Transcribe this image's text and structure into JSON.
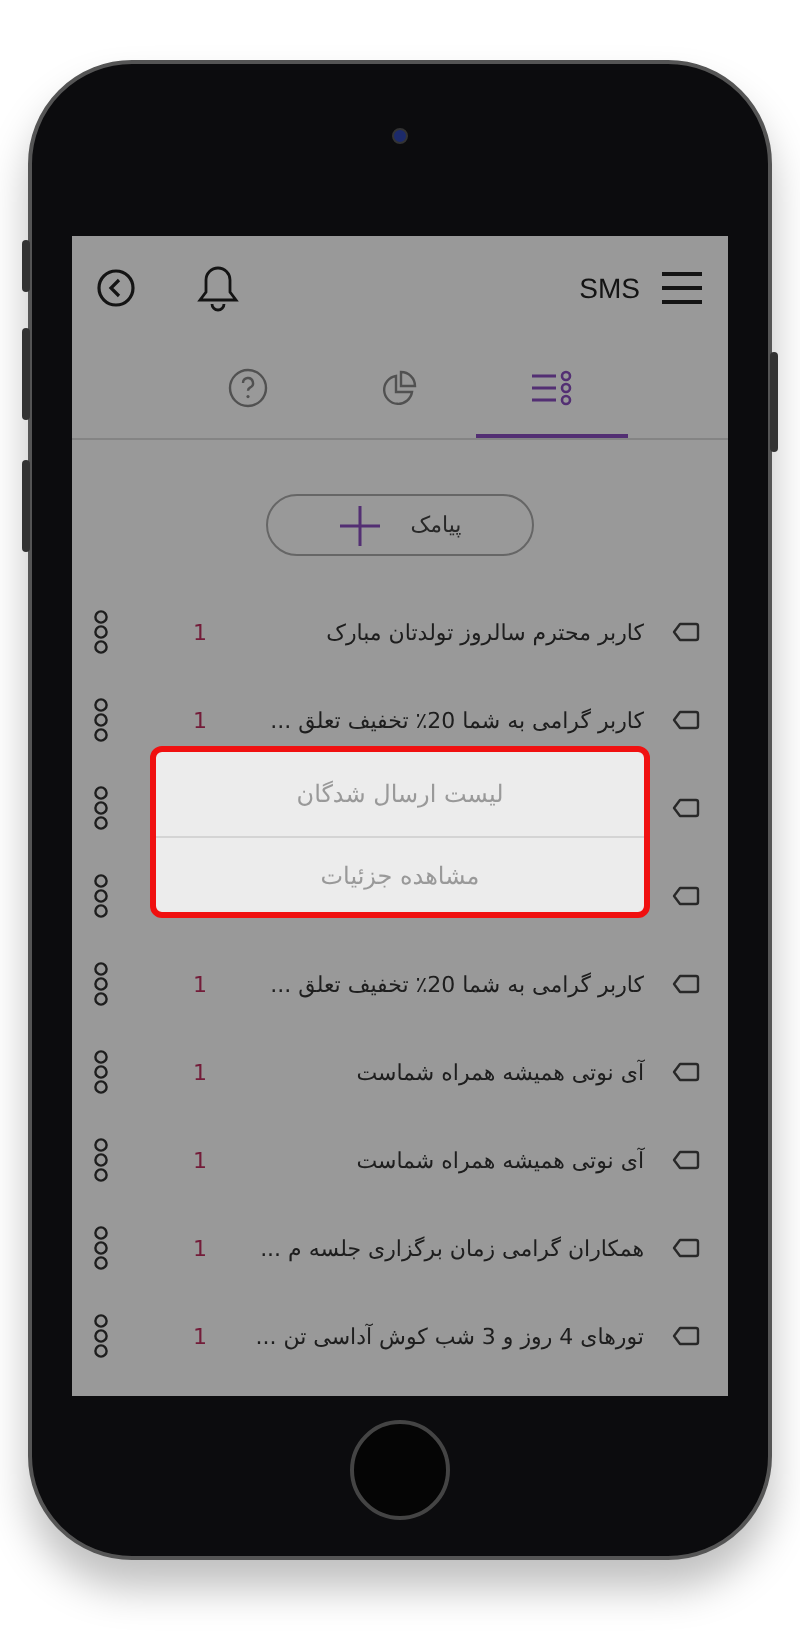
{
  "header": {
    "title": "SMS"
  },
  "tabs": [
    {
      "kind": "help",
      "selected": false
    },
    {
      "kind": "chart",
      "selected": false
    },
    {
      "kind": "list",
      "selected": true
    }
  ],
  "add_button": {
    "label": "پیامک"
  },
  "messages": [
    {
      "kind": "message",
      "text": "کاربر محترم سالروز تولدتان مبارک",
      "count": "1"
    },
    {
      "kind": "message",
      "text": "کاربر گرامی به شما 20٪ تخفیف تعلق ...",
      "count": "1"
    },
    {
      "kind": "covered"
    },
    {
      "kind": "covered"
    },
    {
      "kind": "message",
      "text": "کاربر گرامی به شما 20٪ تخفیف تعلق ...",
      "count": "1"
    },
    {
      "kind": "message",
      "text": "آی نوتی همیشه همراه شماست",
      "count": "1"
    },
    {
      "kind": "message",
      "text": "آی نوتی همیشه همراه شماست",
      "count": "1"
    },
    {
      "kind": "message",
      "text": "همکاران گرامی زمان برگزاری جلسه م ...",
      "count": "1"
    },
    {
      "kind": "message",
      "text": "تورهای 4 روز و 3 شب کوش آداسی تن ...",
      "count": "1"
    }
  ],
  "context_menu": {
    "items": [
      "لیست ارسال شدگان",
      "مشاهده جزئیات"
    ]
  }
}
